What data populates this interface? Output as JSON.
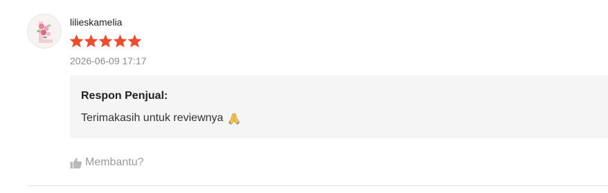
{
  "review": {
    "avatar": "avatar-image",
    "username": "lilieskamelia",
    "rating": 5,
    "rating_max": 5,
    "star_color": "#ee4d2d",
    "timestamp": "2026-06-09 17:17",
    "seller_response": {
      "title": "Respon Penjual:",
      "text": "Terimakasih untuk reviewnya",
      "emoji_icon": "folded-hands-icon"
    },
    "helpful": {
      "icon": "thumbs-up-icon",
      "label": "Membantu?"
    }
  }
}
